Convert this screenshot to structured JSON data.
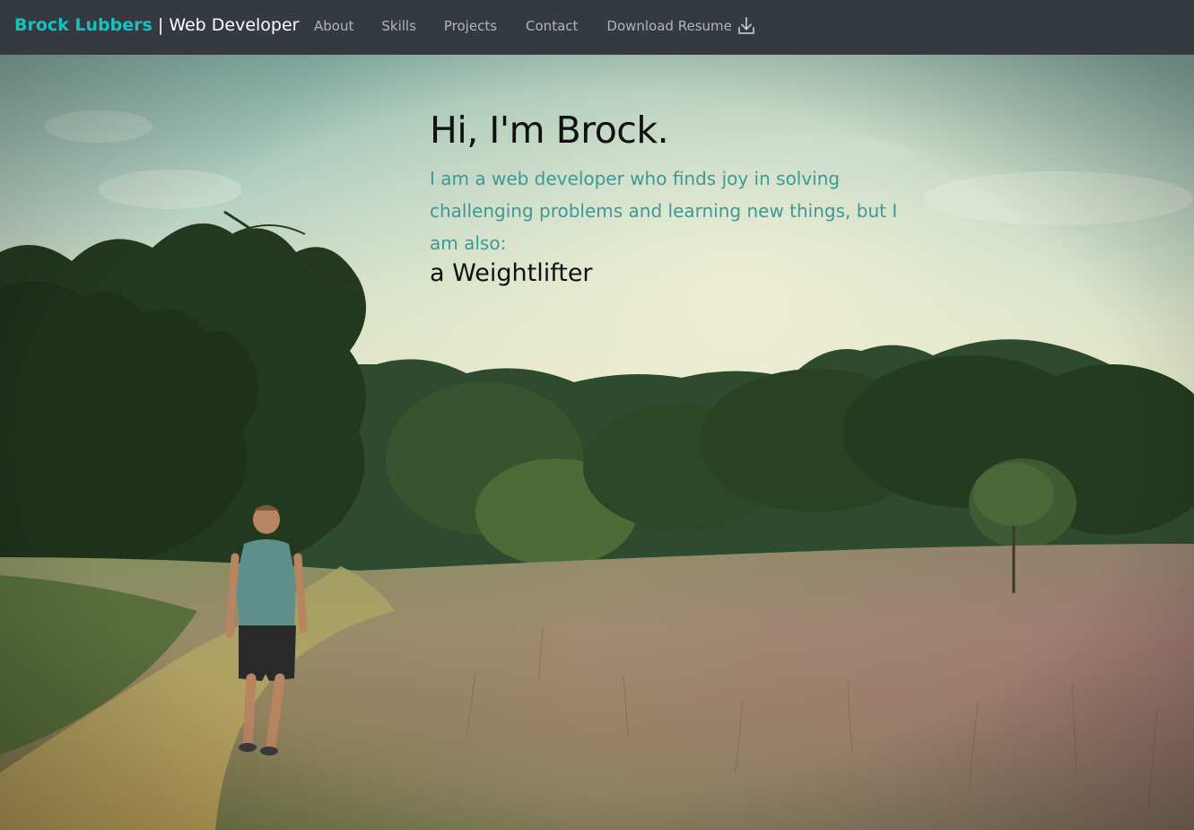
{
  "navbar": {
    "brand_name": "Brock Lubbers",
    "brand_separator": " | ",
    "brand_role": "Web Developer",
    "links": [
      {
        "label": "About"
      },
      {
        "label": "Skills"
      },
      {
        "label": "Projects"
      },
      {
        "label": "Contact"
      }
    ],
    "resume_label": "Download Resume",
    "resume_icon": "download-icon",
    "background_color": "#343a40",
    "brand_color": "#17c1c1"
  },
  "hero": {
    "title": "Hi, I'm Brock.",
    "description": "I am a web developer who finds joy in solving challenging problems and learning new things, but I am also:",
    "rotating_role": "a Weightlifter",
    "description_color": "#3a9a98"
  }
}
